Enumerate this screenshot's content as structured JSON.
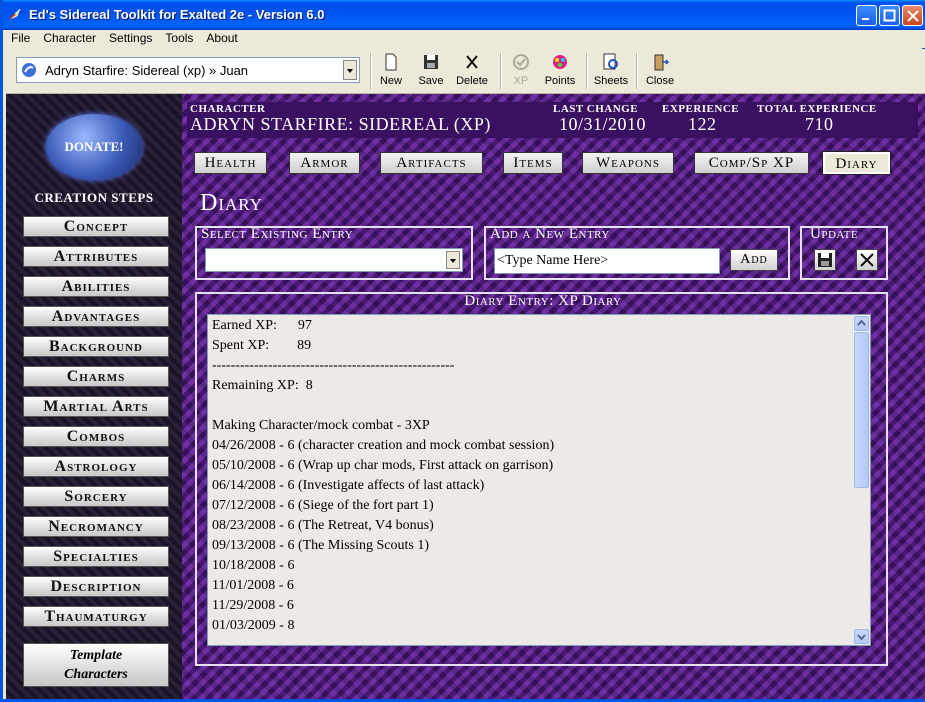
{
  "window": {
    "title": "Ed's Sidereal Toolkit for Exalted 2e - Version 6.0"
  },
  "menu": [
    "File",
    "Character",
    "Settings",
    "Tools",
    "About"
  ],
  "toolbar": {
    "character_select": "Adryn Starfire: Sidereal (xp) » Juan",
    "buttons": [
      {
        "label": "New",
        "icon": "new-file-icon",
        "enabled": true
      },
      {
        "label": "Save",
        "icon": "save-disk-icon",
        "enabled": true
      },
      {
        "label": "Delete",
        "icon": "delete-x-icon",
        "enabled": true
      },
      {
        "label": "XP",
        "icon": "xp-icon",
        "enabled": false
      },
      {
        "label": "Points",
        "icon": "points-icon",
        "enabled": true
      },
      {
        "label": "Sheets",
        "icon": "sheets-icon",
        "enabled": true
      },
      {
        "label": "Close",
        "icon": "close-door-icon",
        "enabled": true
      }
    ]
  },
  "sidebar": {
    "donate_label": "DONATE!",
    "title": "CREATION STEPS",
    "steps": [
      "Concept",
      "Attributes",
      "Abilities",
      "Advantages",
      "Background",
      "Charms",
      "Martial Arts",
      "Combos",
      "Astrology",
      "Sorcery",
      "Necromancy",
      "Specialties",
      "Description",
      "Thaumaturgy"
    ],
    "template_label_1": "Template",
    "template_label_2": "Characters"
  },
  "header": {
    "character_label": "CHARACTER",
    "character_value": "ADRYN STARFIRE: SIDEREAL (XP)",
    "last_change_label": "LAST CHANGE",
    "last_change_value": "10/31/2010",
    "experience_label": "EXPERIENCE",
    "experience_value": "122",
    "total_label": "TOTAL EXPERIENCE",
    "total_value": "710"
  },
  "tabs": [
    "Health",
    "Armor",
    "Artifacts",
    "Items",
    "Weapons",
    "Comp/Sp XP",
    "Diary"
  ],
  "active_tab": "Diary",
  "diary": {
    "title": "Diary",
    "select_label": "Select Existing Entry",
    "add_label": "Add a New Entry",
    "add_placeholder": "<Type Name Here>",
    "add_button": "Add",
    "update_label": "Update",
    "entry_header": "Diary Entry: XP Diary",
    "lines": [
      "Earned XP:      97",
      "Spent XP:        89",
      "----------------------------------------------------",
      "Remaining XP:  8",
      "",
      "Making Character/mock combat - 3XP",
      "04/26/2008 - 6 (character creation and mock combat session)",
      "05/10/2008 - 6 (Wrap up char mods, First attack on garrison)",
      "06/14/2008 - 6 (Investigate affects of last attack)",
      "07/12/2008 - 6 (Siege of the fort part 1)",
      "08/23/2008 - 6 (The Retreat, V4 bonus)",
      "09/13/2008 - 6 (The Missing Scouts 1)",
      "10/18/2008 - 6",
      "11/01/2008 - 6",
      "11/29/2008 - 6",
      "01/03/2009 - 8"
    ]
  }
}
